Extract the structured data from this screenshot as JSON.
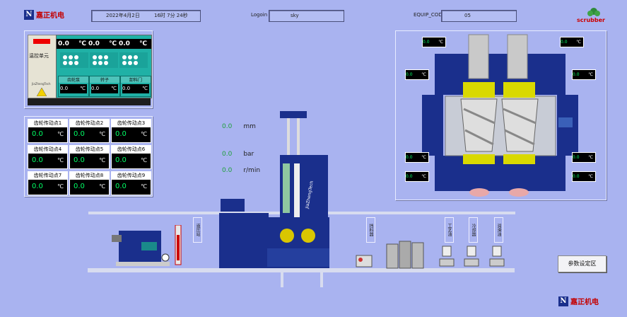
{
  "header": {
    "date": "2022年4月2日",
    "time": "16时  7分  24秒",
    "login_label": "Logoin",
    "login_value": "sky",
    "equip_label": "EQUIP_CODE",
    "equip_value": "05",
    "brand_logo": "嘉正机电",
    "right_logo": "scrubber"
  },
  "temp_unit": {
    "title": "温控单元",
    "brand": "JiaZhengTech",
    "displays": [
      {
        "value": "0.0",
        "unit": "℃"
      },
      {
        "value": "0.0",
        "unit": "℃"
      },
      {
        "value": "0.0",
        "unit": "℃"
      }
    ],
    "zones": [
      {
        "label": "齿轮泵",
        "value": "0.0",
        "unit": "℃"
      },
      {
        "label": "转子",
        "value": "0.0",
        "unit": "℃"
      },
      {
        "label": "卸料门",
        "value": "0.0",
        "unit": "℃"
      }
    ]
  },
  "gear_points": [
    {
      "label": "齿轮传动点1",
      "value": "0.0",
      "unit": "℃"
    },
    {
      "label": "齿轮传动点2",
      "value": "0.0",
      "unit": "℃"
    },
    {
      "label": "齿轮传动点3",
      "value": "0.0",
      "unit": "℃"
    },
    {
      "label": "齿轮传动点4",
      "value": "0.0",
      "unit": "℃"
    },
    {
      "label": "齿轮传动点5",
      "value": "0.0",
      "unit": "℃"
    },
    {
      "label": "齿轮传动点6",
      "value": "0.0",
      "unit": "℃"
    },
    {
      "label": "齿轮传动点7",
      "value": "0.0",
      "unit": "℃"
    },
    {
      "label": "齿轮传动点8",
      "value": "0.0",
      "unit": "℃"
    },
    {
      "label": "齿轮传动点9",
      "value": "0.0",
      "unit": "℃"
    }
  ],
  "readouts": [
    {
      "value": "0.0",
      "unit": "mm"
    },
    {
      "value": "0.0",
      "unit": "bar"
    },
    {
      "value": "0.0",
      "unit": "r/min"
    }
  ],
  "mixer_temps": [
    {
      "value": "0.0",
      "unit": "℃"
    },
    {
      "value": "0.0",
      "unit": "℃"
    },
    {
      "value": "0.0",
      "unit": "℃"
    },
    {
      "value": "0.0",
      "unit": "℃"
    },
    {
      "value": "0.0",
      "unit": "℃"
    },
    {
      "value": "0.0",
      "unit": "℃"
    },
    {
      "value": "0.0",
      "unit": "℃"
    },
    {
      "value": "0.0",
      "unit": "℃"
    }
  ],
  "process_labels": [
    "液压站",
    "挡料器",
    "工艺油",
    "冷却器",
    "润滑油"
  ],
  "machine_brand": "JiaZhengTech",
  "params_button": "参数设定区",
  "colors": {
    "background": "#a9b3f0",
    "machine": "#1a2f8c",
    "digit": "#00ff66"
  }
}
